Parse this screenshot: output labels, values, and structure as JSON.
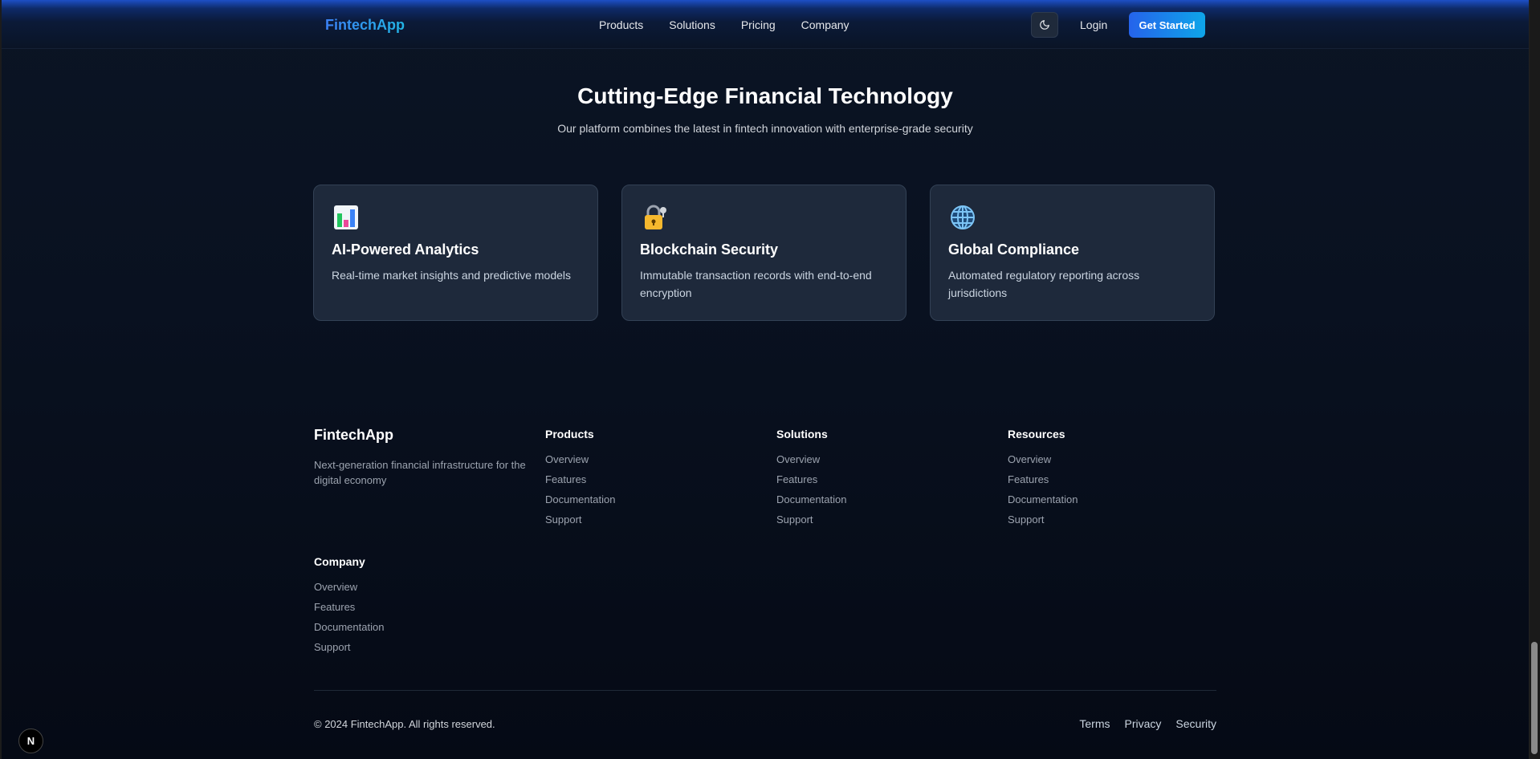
{
  "nav": {
    "brand": "FintechApp",
    "links": [
      "Products",
      "Solutions",
      "Pricing",
      "Company"
    ],
    "theme_icon": "moon-icon",
    "login": "Login",
    "cta": "Get Started"
  },
  "hero": {
    "title": "Cutting-Edge Financial Technology",
    "subtitle": "Our platform combines the latest in fintech innovation with enterprise-grade security"
  },
  "features": [
    {
      "icon": "bar-chart-icon",
      "title": "AI-Powered Analytics",
      "description": "Real-time market insights and predictive models"
    },
    {
      "icon": "lock-icon",
      "title": "Blockchain Security",
      "description": "Immutable transaction records with end-to-end encryption"
    },
    {
      "icon": "globe-icon",
      "title": "Global Compliance",
      "description": "Automated regulatory reporting across jurisdictions"
    }
  ],
  "footer": {
    "brand": "FintechApp",
    "description": "Next-generation financial infrastructure for the digital economy",
    "columns": [
      {
        "title": "Products",
        "links": [
          "Overview",
          "Features",
          "Documentation",
          "Support"
        ]
      },
      {
        "title": "Solutions",
        "links": [
          "Overview",
          "Features",
          "Documentation",
          "Support"
        ]
      },
      {
        "title": "Resources",
        "links": [
          "Overview",
          "Features",
          "Documentation",
          "Support"
        ]
      },
      {
        "title": "Company",
        "links": [
          "Overview",
          "Features",
          "Documentation",
          "Support"
        ]
      }
    ],
    "copyright": "© 2024 FintechApp. All rights reserved.",
    "legal": [
      "Terms",
      "Privacy",
      "Security"
    ]
  },
  "dev_badge": "N"
}
